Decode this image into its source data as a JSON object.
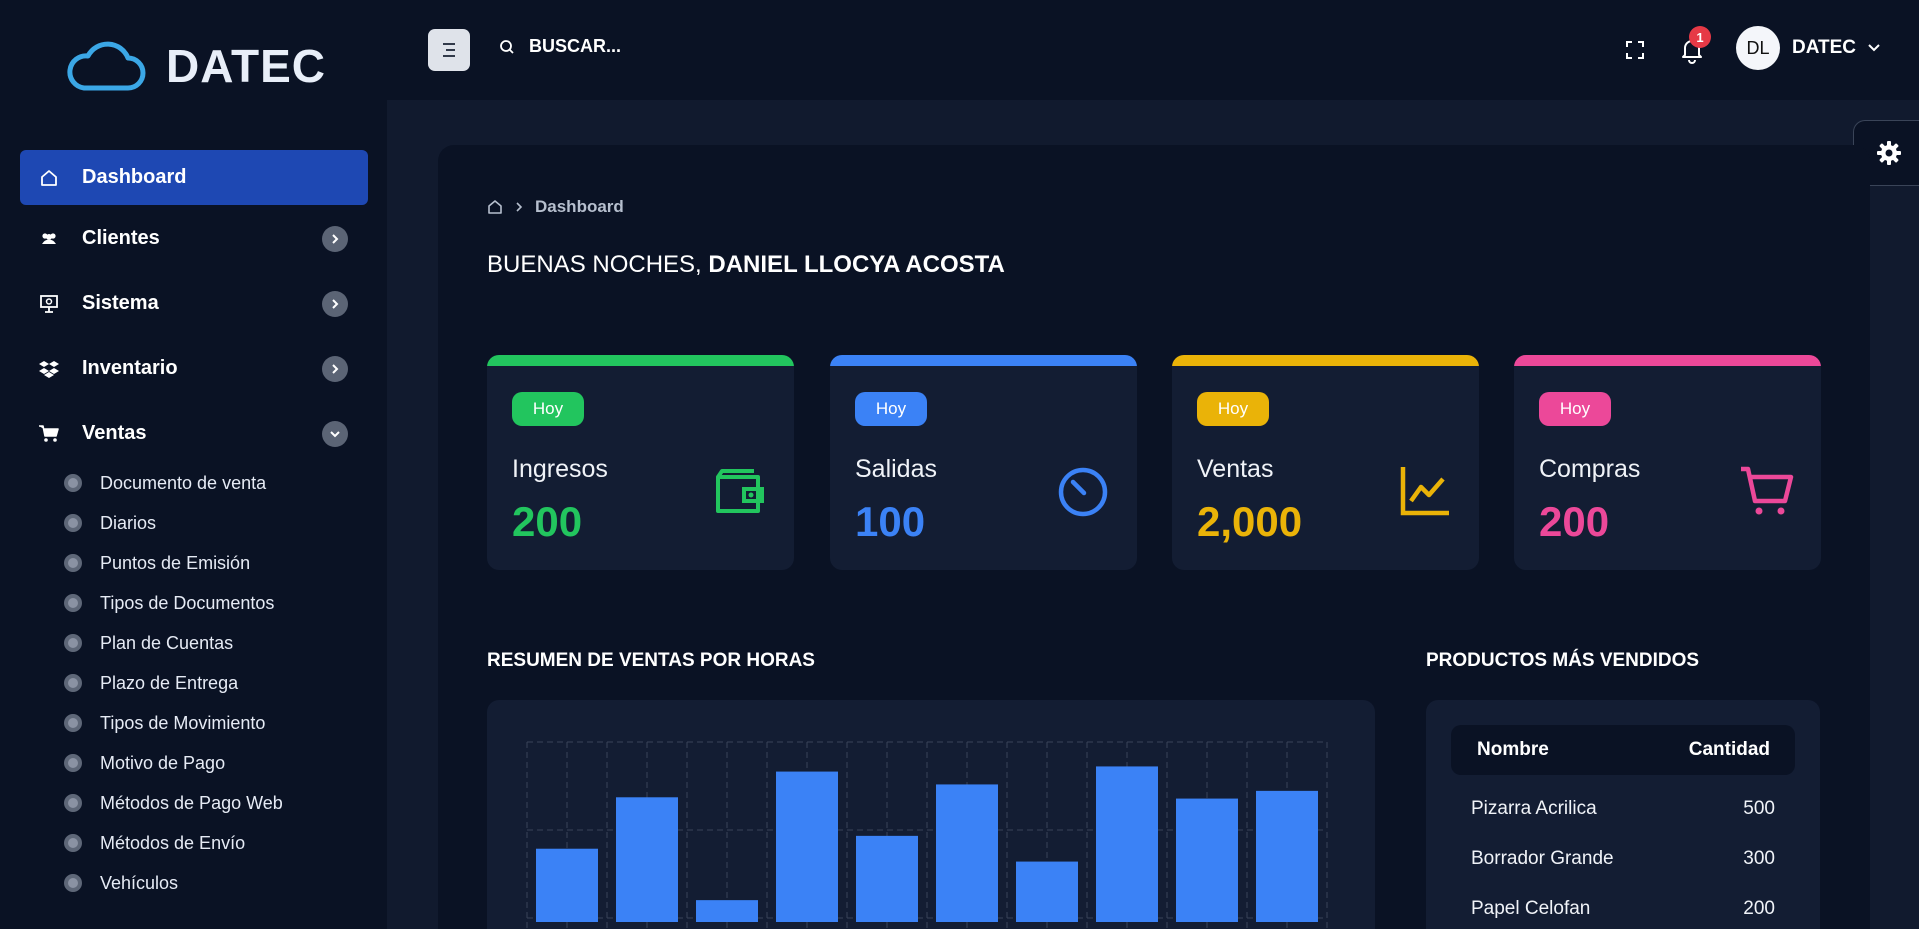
{
  "brand": {
    "name": "DATEC"
  },
  "sidebar": {
    "items": [
      {
        "label": "Dashboard",
        "icon": "home-icon",
        "active": true
      },
      {
        "label": "Clientes",
        "icon": "users-icon"
      },
      {
        "label": "Sistema",
        "icon": "monitor-icon"
      },
      {
        "label": "Inventario",
        "icon": "dropbox-icon"
      },
      {
        "label": "Ventas",
        "icon": "cart-icon",
        "expanded": true
      }
    ],
    "subitems": [
      "Documento de venta",
      "Diarios",
      "Puntos de Emisión",
      "Tipos de Documentos",
      "Plan de Cuentas",
      "Plazo de Entrega",
      "Tipos de Movimiento",
      "Motivo de Pago",
      "Métodos de Pago Web",
      "Métodos de Envío",
      "Vehículos"
    ]
  },
  "topbar": {
    "search_placeholder": "BUSCAR...",
    "notification_count": "1",
    "user_initials": "DL",
    "user_name": "DATEC"
  },
  "breadcrumb": {
    "current": "Dashboard"
  },
  "greeting": {
    "prefix": "BUENAS NOCHES, ",
    "name": "DANIEL LLOCYA ACOSTA"
  },
  "cards": [
    {
      "badge": "Hoy",
      "title": "Ingresos",
      "value": "200",
      "color": "#22c55e",
      "icon": "wallet-icon"
    },
    {
      "badge": "Hoy",
      "title": "Salidas",
      "value": "100",
      "color": "#3b82f6",
      "icon": "timer-icon"
    },
    {
      "badge": "Hoy",
      "title": "Ventas",
      "value": "2,000",
      "color": "#eab308",
      "icon": "trend-chart-icon"
    },
    {
      "badge": "Hoy",
      "title": "Compras",
      "value": "200",
      "color": "#ec4899",
      "icon": "shopping-cart-icon"
    }
  ],
  "sections": {
    "sales_title": "RESUMEN DE VENTAS POR HORAS",
    "products_title": "PRODUCTOS MÁS VENDIDOS"
  },
  "chart_data": {
    "type": "bar",
    "values": [
      57,
      97,
      17,
      117,
      67,
      107,
      47,
      121,
      96,
      102
    ],
    "ylim": [
      0,
      140
    ],
    "grid": true,
    "bar_color": "#3b82f6"
  },
  "products": {
    "headers": [
      "Nombre",
      "Cantidad"
    ],
    "rows": [
      {
        "name": "Pizarra Acrilica",
        "qty": "500"
      },
      {
        "name": "Borrador Grande",
        "qty": "300"
      },
      {
        "name": "Papel Celofan",
        "qty": "200"
      }
    ]
  }
}
